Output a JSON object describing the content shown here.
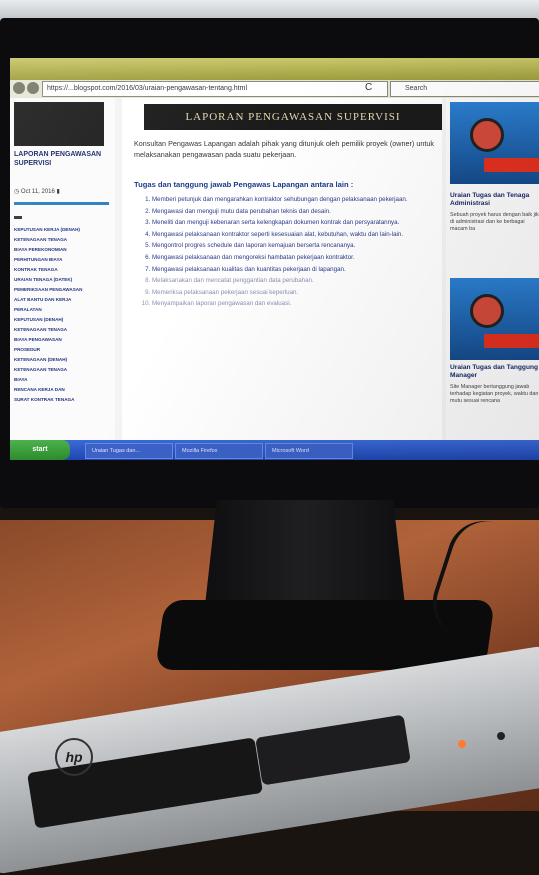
{
  "browser": {
    "url": "https://...blogspot.com/2016/03/uraian-pengawasan-tentang.html",
    "search_placeholder": "Search",
    "refresh_glyph": "C"
  },
  "sidebar": {
    "blog_title": "LAPORAN PENGAWASAN SUPERVISI",
    "date": "Oct 11, 2016",
    "items": [
      "KEPUTUSAN KERJA (DENAH)",
      "KETENAGAAN TENAGA",
      "BIAYA PEREKONOMIAN",
      "PERHITUNGAN BIAYA",
      "KONTRAK TENAGA",
      "Uraian Tenaga (DATEK)",
      "Pemeriksaan Pengawasan",
      "Alat Bantu dan Kerja",
      "Peralatan",
      "KEPUTUSAN (DENAH)",
      "KETENAGAAN TENAGA",
      "BIAYA PENGAWASAN",
      "PROSEDUR",
      "KETENAGAAN (DENAH)",
      "KETENAGAAN TENAGA",
      "BIAYA",
      "RENCANA KERJA DAN",
      "SURAT KONTRAK TENAGA"
    ]
  },
  "main": {
    "banner": "LAPORAN PENGAWASAN SUPERVISI",
    "intro": "Konsultan Pengawas Lapangan adalah pihak yang ditunjuk oleh pemilik proyek (owner) untuk melaksanakan pengawasan pada suatu pekerjaan.",
    "section_heading": "Tugas dan tanggung jawab Pengawas Lapangan antara lain :",
    "tasks": [
      "Memberi petunjuk dan mengarahkan kontraktor sehubungan dengan pelaksanaan pekerjaan.",
      "Mengawasi dan menguji mutu data perubahan teknis dan desain.",
      "Meneliti dan menguji kebenaran serta kelengkapan dokumen kontrak dan persyaratannya.",
      "Mengawasi pelaksanaan kontraktor seperti kesesuaian alat, kebutuhan, waktu dan lain-lain.",
      "Mengontrol progres schedule dan laporan kemajuan berserta rencananya.",
      "Mengawasi pelaksanaan dan mengoreksi hambatan pekerjaan kontraktor.",
      "Mengawasi pelaksanaan kualitas dan kuantitas pekerjaan di lapangan.",
      "Melaksanakan dan mencatat penggantian data perubahan.",
      "Memeriksa pelaksanaan pekerjaan sesuai keperluan.",
      "Menyampaikan laporan pengawasan dan evaluasi."
    ]
  },
  "right": {
    "post1_title": "Uraian Tugas dan Tenaga Administrasi",
    "post1_text": "Sebuah proyek harus dengan baik jika di administrasi dan ke berbagai macam ba",
    "post2_title": "Uraian Tugas dan Tanggung Manager",
    "post2_text": "Site Manager bertanggung jawab terhadap kegiatan proyek, waktu dan mutu sesuai rencana"
  },
  "taskbar": {
    "start": "start",
    "items": [
      "Uraian Tugas dan...",
      "Mozilla Firefox",
      "Microsoft Word"
    ]
  },
  "device": {
    "brand_logo": "hp"
  },
  "colors": {
    "link": "#1a2a6a",
    "banner_bg": "#1b1b1b",
    "taskbar": "#1f46b0",
    "start_button": "#2a8a2a",
    "accent_red": "#e03020",
    "desk": "#b0633a"
  }
}
